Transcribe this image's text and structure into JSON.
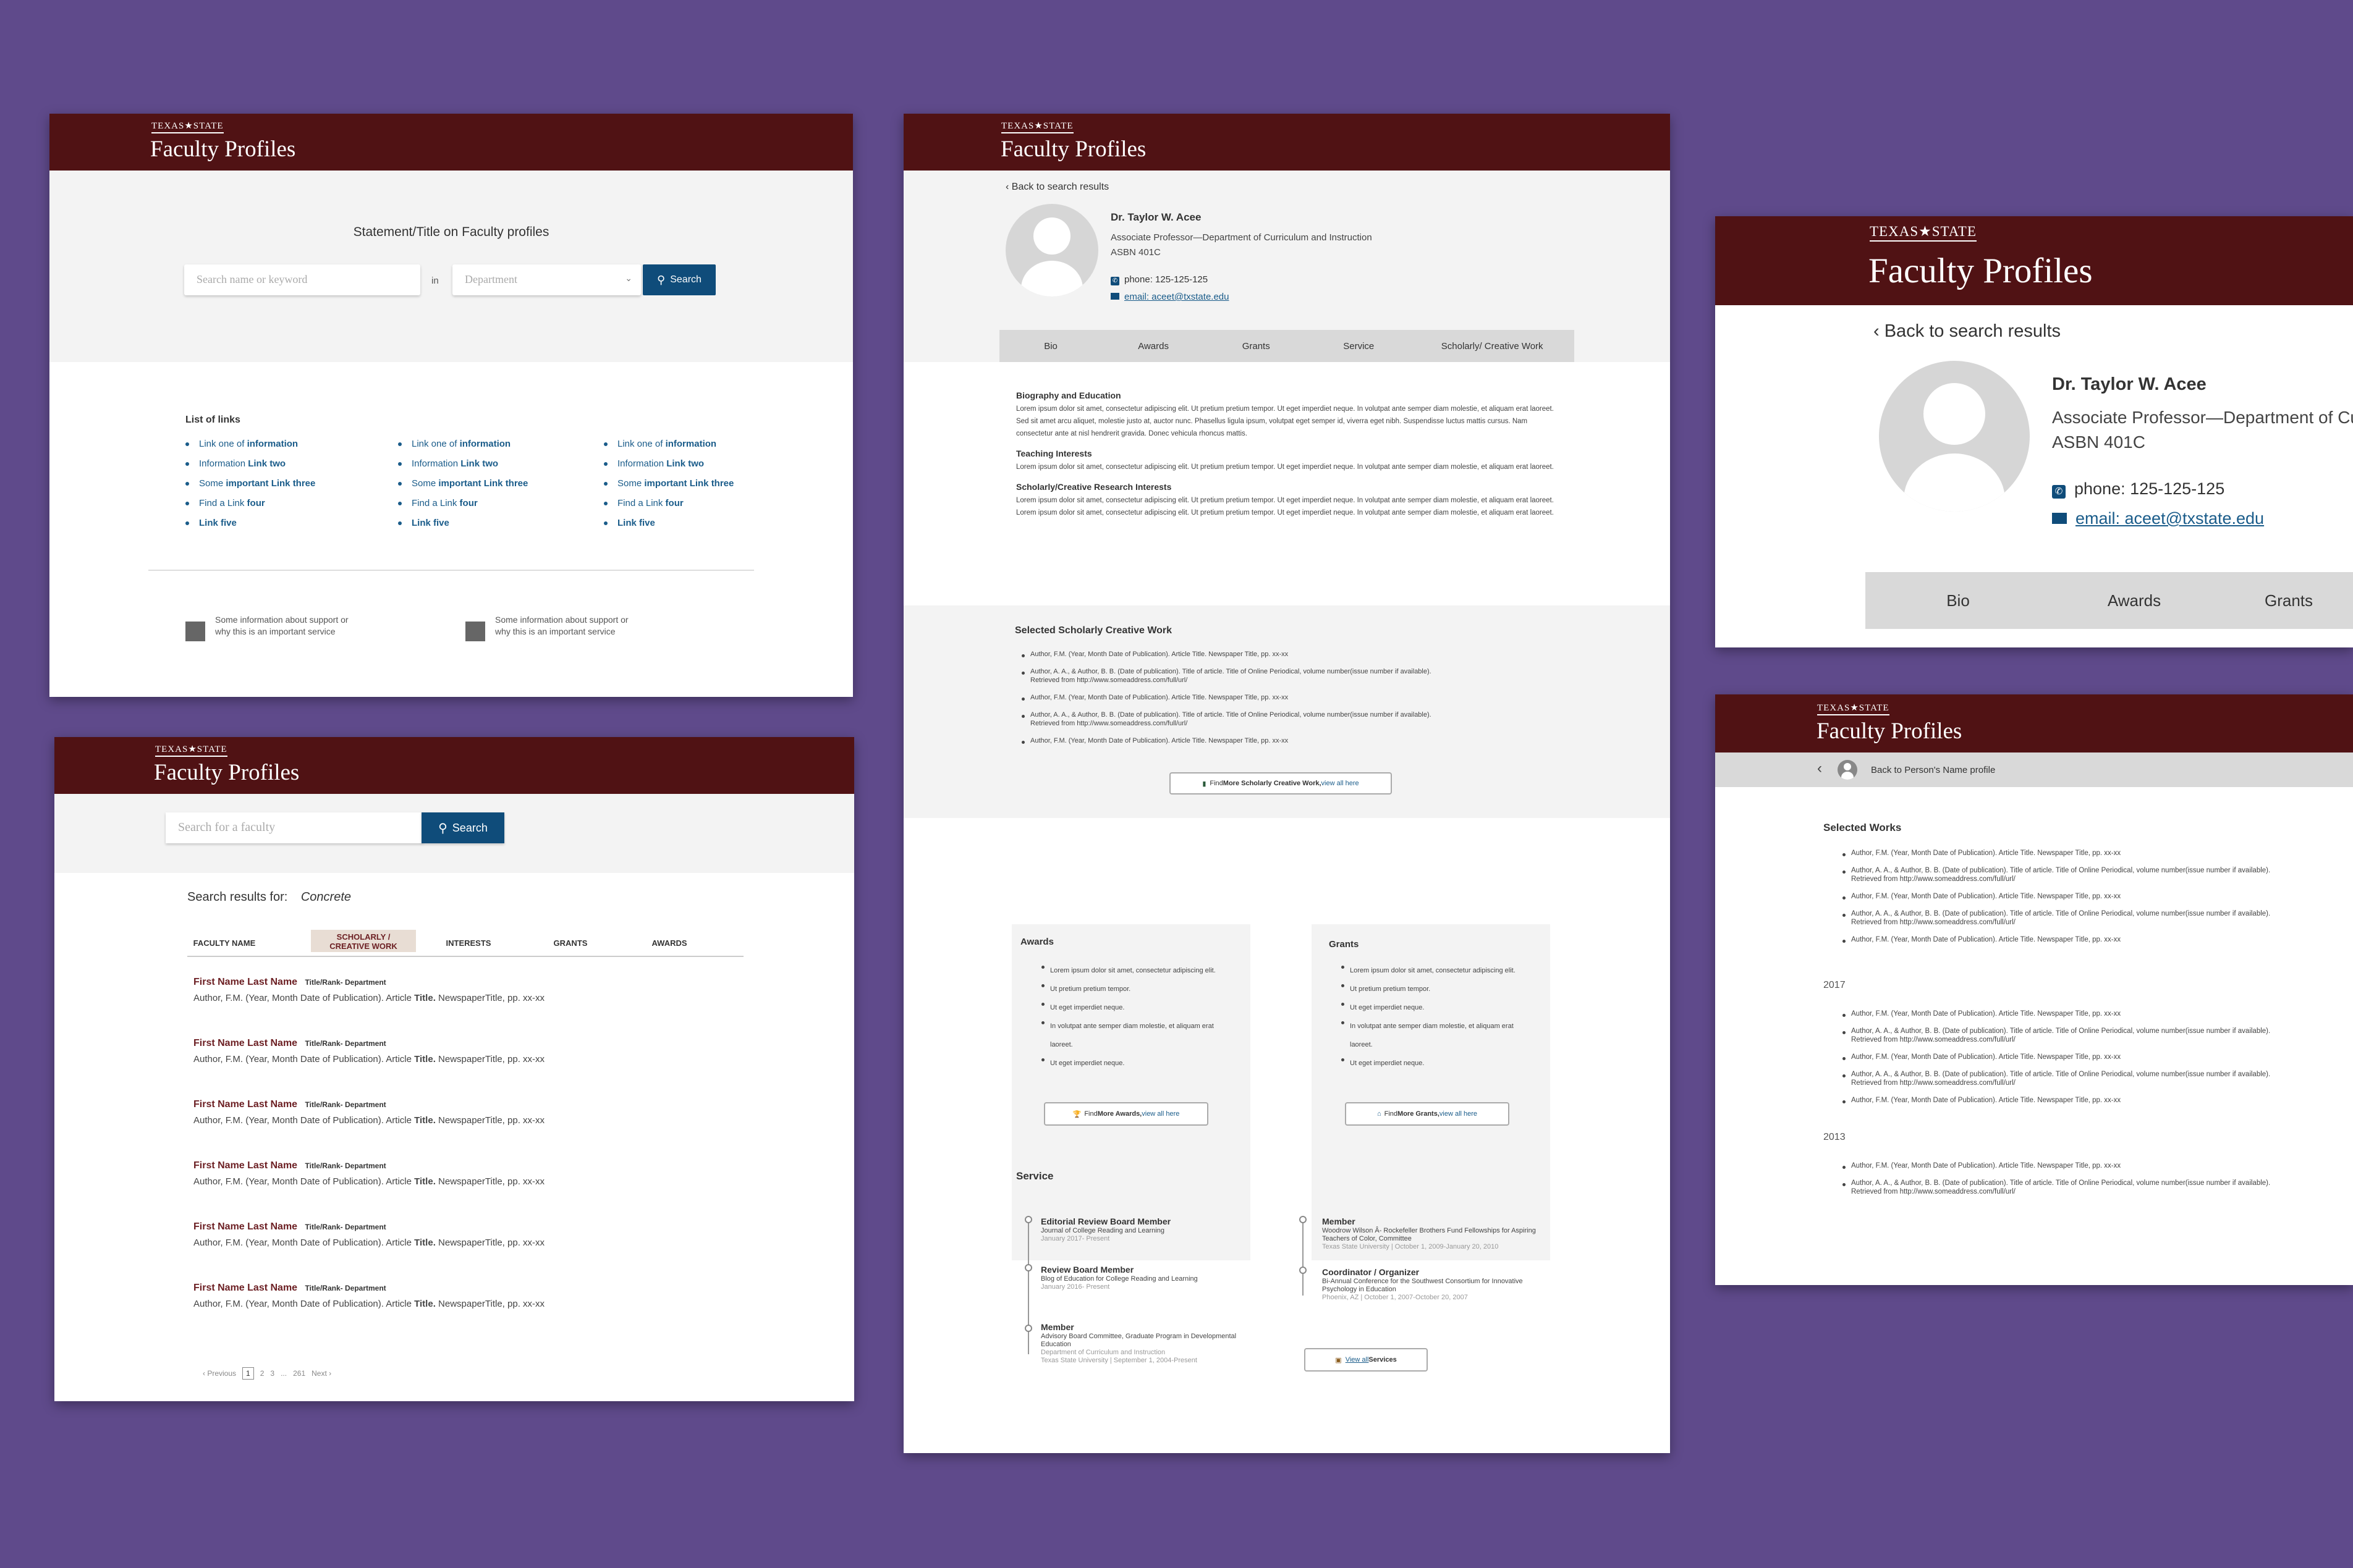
{
  "brand": "TEXAS★STATE",
  "app_title": "Faculty Profiles",
  "colors": {
    "maroon": "#501214",
    "background": "#5f4a8b",
    "link_blue": "#1a5c8a",
    "button_blue": "#0f4c7a"
  },
  "p1": {
    "statement": "Statement/Title on Faculty profiles",
    "search_placeholder": "Search name or keyword",
    "in_label": "in",
    "dept_placeholder": "Department",
    "search_button": "Search",
    "links_title": "List of links",
    "col1": [
      [
        "Link one of ",
        "information"
      ],
      [
        "Information ",
        "Link two"
      ],
      [
        "Some ",
        "important Link three"
      ],
      [
        "Find a Link ",
        "four"
      ],
      [
        "",
        "Link five"
      ]
    ],
    "col2": [
      [
        "Link one of ",
        "information"
      ],
      [
        "Information ",
        "Link two"
      ],
      [
        "Some ",
        "important Link three"
      ],
      [
        "Find a Link ",
        "four"
      ],
      [
        "",
        "Link five"
      ]
    ],
    "col3": [
      [
        "Link one of ",
        "information"
      ],
      [
        "Information ",
        "Link two"
      ],
      [
        "Some ",
        "important Link three"
      ],
      [
        "Find a Link ",
        "four"
      ],
      [
        "",
        "Link five"
      ]
    ],
    "support1_line1": "Some information about support or",
    "support1_line2": "why this is an important service",
    "support2_line1": "Some information about support or",
    "support2_line2": "why this is an important service"
  },
  "p2": {
    "search_placeholder": "Search for a faculty",
    "search_button": "Search",
    "results_label": "Search results for:",
    "query": "Concrete",
    "tabs": [
      "FACULTY NAME",
      "SCHOLARLY / CREATIVE WORK",
      "INTERESTS",
      "GRANTS",
      "AWARDS"
    ],
    "results": [
      {
        "name": "First Name Last Name",
        "role": "Title/Rank- Department",
        "cite_pre": "Author, F.M. (Year, Month Date of Publication). Article ",
        "cite_bold": "Title.",
        "cite_post": " NewspaperTitle, pp. xx-xx"
      },
      {
        "name": "First Name Last Name",
        "role": "Title/Rank- Department",
        "cite_pre": "Author, F.M. (Year, Month Date of Publication). Article ",
        "cite_bold": "Title.",
        "cite_post": " NewspaperTitle, pp. xx-xx"
      },
      {
        "name": "First Name Last Name",
        "role": "Title/Rank- Department",
        "cite_pre": "Author, F.M. (Year, Month Date of Publication). Article ",
        "cite_bold": "Title.",
        "cite_post": " NewspaperTitle, pp. xx-xx"
      },
      {
        "name": "First Name Last Name",
        "role": "Title/Rank- Department",
        "cite_pre": "Author, F.M. (Year, Month Date of Publication). Article ",
        "cite_bold": "Title.",
        "cite_post": " NewspaperTitle, pp. xx-xx"
      },
      {
        "name": "First Name Last Name",
        "role": "Title/Rank- Department",
        "cite_pre": "Author, F.M. (Year, Month Date of Publication). Article ",
        "cite_bold": "Title.",
        "cite_post": " NewspaperTitle, pp. xx-xx"
      },
      {
        "name": "First Name Last Name",
        "role": "Title/Rank- Department",
        "cite_pre": "Author, F.M. (Year, Month Date of Publication). Article ",
        "cite_bold": "Title.",
        "cite_post": " NewspaperTitle, pp. xx-xx"
      }
    ],
    "pager": [
      "‹ Previous",
      "1",
      "2",
      "3",
      "...",
      "261",
      "Next ›"
    ]
  },
  "p3": {
    "back": "Back to search results",
    "name": "Dr. Taylor W. Acee",
    "position": "Associate Professor—Department of Curriculum and Instruction",
    "office": "ASBN 401C",
    "phone": "phone: 125-125-125",
    "email": "email: aceet@txstate.edu",
    "tabs": [
      "Bio",
      "Awards",
      "Grants",
      "Service",
      "Scholarly/ Creative Work"
    ],
    "bio_h": "Biography and Education",
    "bio_t": "Lorem ipsum dolor sit amet, consectetur adipiscing elit. Ut pretium pretium tempor. Ut eget imperdiet neque. In volutpat ante semper diam molestie, et aliquam erat laoreet. Sed sit amet arcu aliquet, molestie justo at, auctor nunc. Phasellus ligula ipsum, volutpat eget semper id, viverra eget nibh. Suspendisse luctus mattis cursus. Nam consectetur ante at nisl hendrerit gravida. Donec vehicula rhoncus mattis.",
    "teach_h": "Teaching Interests",
    "teach_t": "Lorem ipsum dolor sit amet, consectetur adipiscing elit. Ut pretium pretium tempor. Ut eget imperdiet neque. In volutpat ante semper diam molestie, et aliquam erat laoreet.",
    "sch_h": "Scholarly/Creative Research Interests",
    "sch_t": "Lorem ipsum dolor sit amet, consectetur adipiscing elit. Ut pretium pretium tempor. Ut eget imperdiet neque. In volutpat ante semper diam molestie, et aliquam erat laoreet. Lorem ipsum dolor sit amet, consectetur adipiscing elit. Ut pretium pretium tempor. Ut eget imperdiet neque. In volutpat ante semper diam molestie, et aliquam erat laoreet.",
    "sel_h": "Selected Scholarly Creative Work",
    "refs": [
      "Author, F.M. (Year, Month Date of Publication). Article Title. Newspaper Title, pp. xx-xx",
      "Author, A. A., & Author, B. B. (Date of publication). Title of article. Title of Online Periodical, volume number(issue number if available). Retrieved from http://www.someaddress.com/full/url/",
      "Author, F.M. (Year, Month Date of Publication). Article Title. Newspaper Title, pp. xx-xx",
      "Author, A. A., & Author, B. B. (Date of publication). Title of article. Title of Online Periodical, volume number(issue number if available). Retrieved from http://www.someaddress.com/full/url/",
      "Author, F.M. (Year, Month Date of Publication). Article Title. Newspaper Title, pp. xx-xx"
    ],
    "more_sch_pre": "Find ",
    "more_sch_bold": "More Scholarly Creative Work,",
    "more_sch_link": " view all here",
    "awards_h": "Awards",
    "awards": [
      "Lorem ipsum dolor sit amet, consectetur adipiscing elit.",
      "Ut pretium pretium tempor.",
      "Ut eget imperdiet neque.",
      "In volutpat ante semper diam molestie, et aliquam erat laoreet.",
      "Ut eget imperdiet neque."
    ],
    "more_awards_pre": "Find ",
    "more_awards_bold": "More Awards,",
    "more_awards_link": " view all here",
    "grants_h": "Grants",
    "grants": [
      "Lorem ipsum dolor sit amet, consectetur adipiscing elit.",
      "Ut pretium pretium tempor.",
      "Ut eget imperdiet neque.",
      "In volutpat ante semper diam molestie, et aliquam erat laoreet.",
      "Ut eget imperdiet neque."
    ],
    "more_grants_pre": "Find ",
    "more_grants_bold": "More Grants,",
    "more_grants_link": " view all here",
    "service_h": "Service",
    "service_left": [
      {
        "title": "Editorial Review Board Member",
        "sub": "Journal of College Reading and Learning",
        "date": "January 2017- Present"
      },
      {
        "title": "Review Board Member",
        "sub": "Blog of Education for College Reading and Learning",
        "date": "January 2016- Present"
      },
      {
        "title": "Member",
        "sub": "Advisory Board Committee, Graduate Program in Developmental Education",
        "date": "Department of Curriculum and Instruction",
        "date2": "Texas State University  |  September 1, 2004-Present"
      }
    ],
    "service_right": [
      {
        "title": "Member",
        "sub": "Woodrow Wilson Â- Rockefeller Brothers Fund Fellowships for Aspiring Teachers of Color, Committee",
        "date": "Texas State University  |  October 1, 2009-January 20, 2010"
      },
      {
        "title": "Coordinator / Organizer",
        "sub": "Bi-Annual Conference for the Southwest Consortium for Innovative Psychology in Education",
        "date": "Phoenix, AZ  |  October 1, 2007-October 20, 2007"
      }
    ],
    "view_all_link": "View all",
    "view_all_bold": " Services"
  },
  "p4": {
    "back": "Back to search results",
    "name": "Dr. Taylor W. Acee",
    "position": "Associate Professor—Department of Cu",
    "office": "ASBN 401C",
    "phone": "phone: 125-125-125",
    "email": "email: aceet@txstate.edu",
    "tabs": [
      "Bio",
      "Awards",
      "Grants"
    ]
  },
  "p5": {
    "back": "Back to Person's Name profile",
    "section": "Selected Works",
    "group1": [
      "Author, F.M. (Year, Month Date of Publication). Article Title. Newspaper Title, pp. xx-xx",
      "Author, A. A., & Author, B. B. (Date of publication). Title of article. Title of Online Periodical, volume number(issue number if available). Retrieved from http://www.someaddress.com/full/url/",
      "Author, F.M. (Year, Month Date of Publication). Article Title. Newspaper Title, pp. xx-xx",
      "Author, A. A., & Author, B. B. (Date of publication). Title of article. Title of Online Periodical, volume number(issue number if available). Retrieved from http://www.someaddress.com/full/url/",
      "Author, F.M. (Year, Month Date of Publication). Article Title. Newspaper Title, pp. xx-xx"
    ],
    "year1": "2017",
    "group2": [
      "Author, F.M. (Year, Month Date of Publication). Article Title. Newspaper Title, pp. xx-xx",
      "Author, A. A., & Author, B. B. (Date of publication). Title of article. Title of Online Periodical, volume number(issue number if available). Retrieved from http://www.someaddress.com/full/url/",
      "Author, F.M. (Year, Month Date of Publication). Article Title. Newspaper Title, pp. xx-xx",
      "Author, A. A., & Author, B. B. (Date of publication). Title of article. Title of Online Periodical, volume number(issue number if available). Retrieved from http://www.someaddress.com/full/url/",
      "Author, F.M. (Year, Month Date of Publication). Article Title. Newspaper Title, pp. xx-xx"
    ],
    "year2": "2013",
    "group3": [
      "Author, F.M. (Year, Month Date of Publication). Article Title. Newspaper Title, pp. xx-xx",
      "Author, A. A., & Author, B. B. (Date of publication). Title of article. Title of Online Periodical, volume number(issue number if available). Retrieved from http://www.someaddress.com/full/url/"
    ]
  }
}
